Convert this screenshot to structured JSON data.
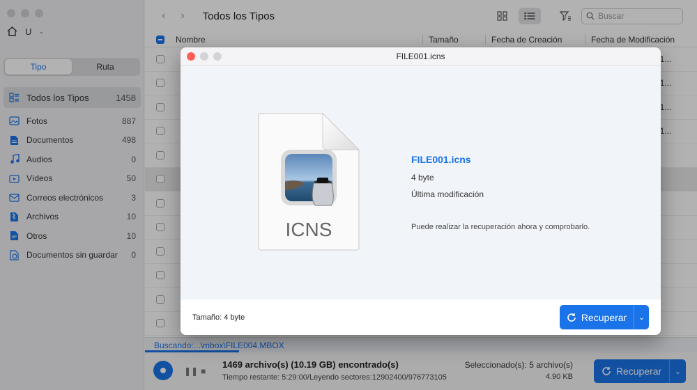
{
  "sidebar": {
    "user": "U",
    "tabs": [
      "Tipo",
      "Ruta"
    ],
    "items": [
      {
        "label": "Todos los Tipos",
        "count": "1458",
        "icon": "all-types-icon"
      },
      {
        "label": "Fotos",
        "count": "887",
        "icon": "photo-icon"
      },
      {
        "label": "Documentos",
        "count": "498",
        "icon": "document-icon"
      },
      {
        "label": "Audios",
        "count": "0",
        "icon": "audio-icon"
      },
      {
        "label": "Vídeos",
        "count": "50",
        "icon": "video-icon"
      },
      {
        "label": "Correos electrónicos",
        "count": "3",
        "icon": "mail-icon"
      },
      {
        "label": "Archivos",
        "count": "10",
        "icon": "archive-icon"
      },
      {
        "label": "Otros",
        "count": "10",
        "icon": "other-icon"
      },
      {
        "label": "Documentos sin guardar",
        "count": "0",
        "icon": "unsaved-doc-icon"
      }
    ]
  },
  "toolbar": {
    "title": "Todos los Tipos",
    "search_placeholder": "Buscar"
  },
  "table": {
    "columns": [
      "Nombre",
      "Tamaño",
      "Fecha de Creación",
      "Fecha de Modificación"
    ],
    "partial_dates": [
      "t 1...",
      "t 1...",
      "t 1...",
      "t 1..."
    ]
  },
  "status": {
    "scanning": "Buscando:...\\mbox\\FILE004.MBOX",
    "found": "1469 archivo(s) (10.19 GB) encontrado(s)",
    "remaining": "Tiempo restante: 5:29:00/Leyendo sectores:12902400/976773105",
    "selected": "Seleccionado(s): 5 archivo(s)",
    "selected_size": "4.90 KB",
    "recover_label": "Recuperar"
  },
  "modal": {
    "title": "FILE001.icns",
    "file_name": "FILE001.icns",
    "file_size": "4 byte",
    "last_modified": "Última modificación",
    "note": "Puede realizar la recuperación ahora y comprobarlo.",
    "icon_text": "ICNS",
    "footer_size": "Tamaño: 4 byte",
    "recover_label": "Recuperar"
  },
  "colors": {
    "accent": "#1a73e8",
    "close": "#ff5f57"
  }
}
